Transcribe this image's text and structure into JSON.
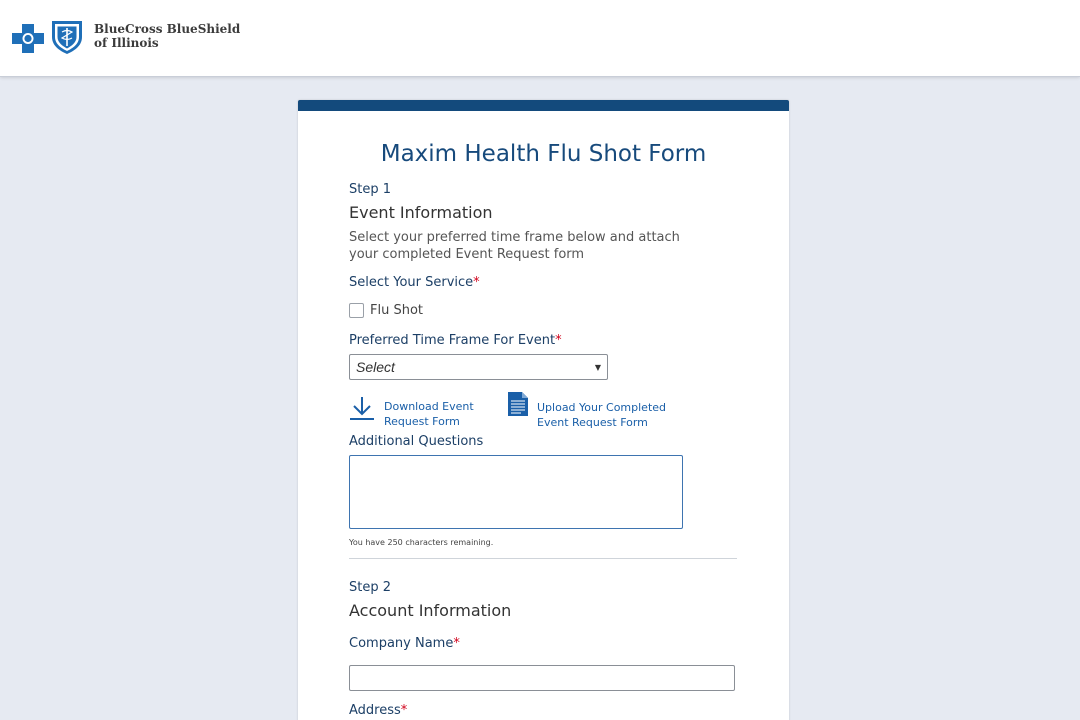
{
  "header": {
    "brand_line1": "BlueCross BlueShield",
    "brand_line2": "of Illinois",
    "brand_color": "#1f6fb8"
  },
  "form": {
    "title": "Maxim Health Flu Shot Form",
    "accent_color": "#134a7c",
    "step1": {
      "step_label": "Step 1",
      "section_title": "Event Information",
      "description_line1": "Select your preferred time frame below and attach",
      "description_line2": "your completed Event Request form",
      "service_label": "Select Your Service",
      "required_mark": "*",
      "service_options": [
        {
          "label": "Flu Shot",
          "checked": false
        }
      ],
      "time_frame_label": "Preferred Time Frame For Event",
      "time_frame_value": "Select",
      "download_link_line1": "Download Event",
      "download_link_line2": "Request Form",
      "upload_link_line1": "Upload Your Completed",
      "upload_link_line2": "Event Request Form",
      "questions_label": "Additional Questions",
      "questions_value": "",
      "chars_remaining": "You have 250 characters remaining."
    },
    "step2": {
      "step_label": "Step 2",
      "section_title": "Account Information",
      "company_label": "Company Name",
      "company_value": "",
      "address_label": "Address"
    }
  }
}
